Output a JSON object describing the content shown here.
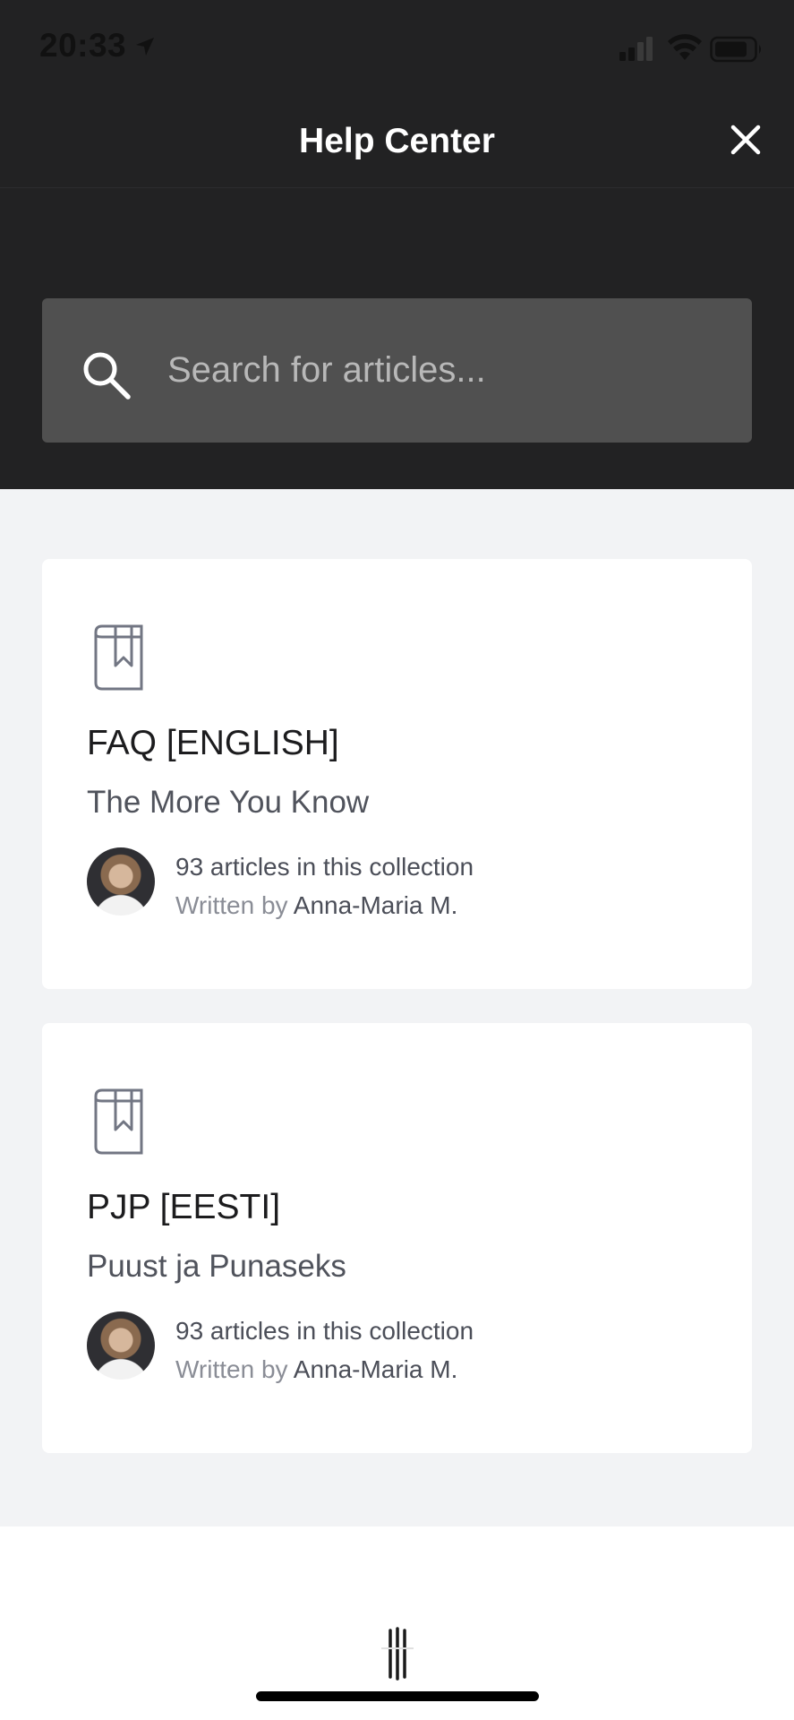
{
  "status_bar": {
    "time": "20:33"
  },
  "header": {
    "title": "Help Center"
  },
  "search": {
    "placeholder": "Search for articles..."
  },
  "collections": [
    {
      "title": "FAQ [ENGLISH]",
      "description": "The More You Know",
      "article_count": "93 articles in this collection",
      "written_by": "Written by",
      "author": "Anna-Maria M."
    },
    {
      "title": "PJP [EESTI]",
      "description": "Puust ja Punaseks",
      "article_count": "93 articles in this collection",
      "written_by": "Written by",
      "author": "Anna-Maria M."
    }
  ],
  "icons": {
    "close": "close-icon",
    "search": "search-icon",
    "collection": "book-bookmark-icon",
    "branding": "intercom-logo-icon"
  },
  "colors": {
    "header_bg": "#222223",
    "search_bg": "#505050",
    "page_bg": "#f2f3f5",
    "card_bg": "#ffffff"
  }
}
